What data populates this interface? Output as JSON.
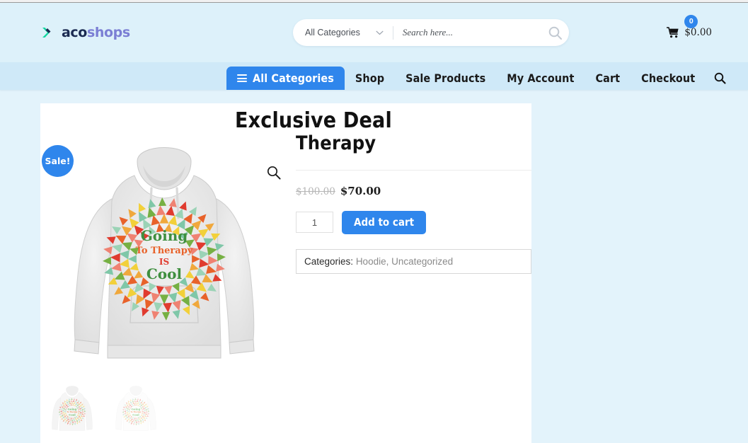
{
  "brand": {
    "name_part1": "aco",
    "name_part2": "shops",
    "logo_icon": "arrow-mark-icon"
  },
  "header": {
    "search": {
      "category_label": "All Categories",
      "placeholder": "Search here...",
      "value": "",
      "chevron_icon": "chevron-down-icon",
      "search_icon": "search-icon"
    },
    "cart": {
      "icon": "shopping-cart-icon",
      "count": "0",
      "total": "$0.00"
    }
  },
  "nav": {
    "all_categories": {
      "label": "All Categories",
      "icon": "hamburger-icon"
    },
    "items": [
      {
        "label": "Shop"
      },
      {
        "label": "Sale Products"
      },
      {
        "label": "My Account"
      },
      {
        "label": "Cart"
      },
      {
        "label": "Checkout"
      }
    ],
    "search_icon": "search-icon"
  },
  "product": {
    "section_heading": "Exclusive Deal",
    "title": "Therapy",
    "sale_badge": "Sale!",
    "zoom_icon": "magnifier-zoom-icon",
    "price_old": "$100.00",
    "price_new": "$70.00",
    "quantity": "1",
    "add_to_cart_label": "Add to cart",
    "categories_label": "Categories:",
    "categories_value": "Hoodie, Uncategorized",
    "graphic_text": {
      "line1": "Going",
      "line2": "To Therapy",
      "line3": "IS",
      "line4": "Cool"
    }
  },
  "colors": {
    "accent_blue": "#2f86ec",
    "header_bg": "#ddf1fa",
    "nav_bg": "#cfe9f8",
    "page_bg": "#e3f3fb",
    "logo_dark": "#1b2b52",
    "logo_purple": "#7b7fd4",
    "logo_teal": "#12d6a0"
  }
}
